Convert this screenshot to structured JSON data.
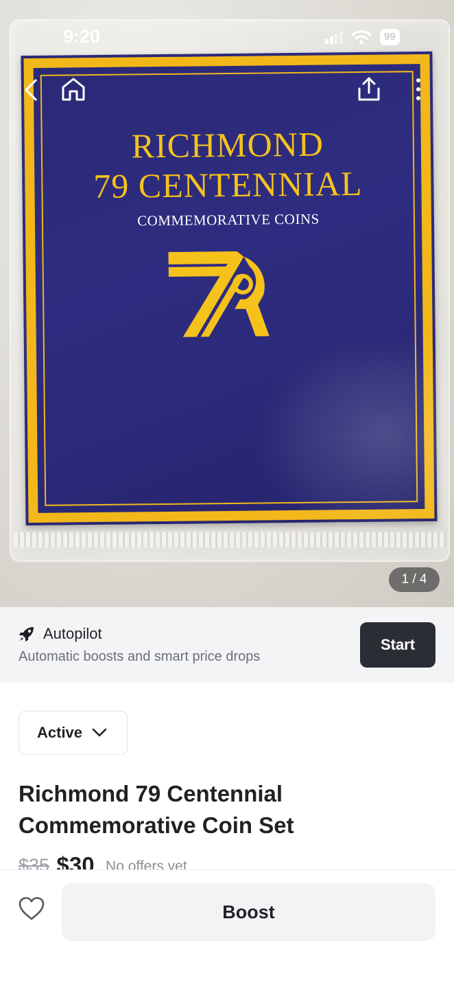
{
  "status_bar": {
    "time": "9:20",
    "battery": "99"
  },
  "photo": {
    "cover_title_line1": "RICHMOND",
    "cover_title_line2": "79 CENTENNIAL",
    "cover_subtitle": "COMMEMORATIVE COINS",
    "page_indicator": "1 / 4"
  },
  "icons": {
    "back": "chevron-left-icon",
    "home": "home-icon",
    "share": "share-icon",
    "more": "more-vertical-icon",
    "autopilot": "rocket-icon",
    "status_dropdown": "chevron-down-icon",
    "favorite": "heart-icon"
  },
  "autopilot": {
    "title": "Autopilot",
    "subtitle": "Automatic boosts and smart price drops",
    "start_label": "Start"
  },
  "listing": {
    "status": "Active",
    "title": "Richmond 79 Centennial Commemorative Coin Set",
    "original_price": "$35",
    "price": "$30",
    "offers_text": "No offers yet"
  },
  "bottom_bar": {
    "boost_label": "Boost"
  },
  "colors": {
    "cover_blue": "#2b2a76",
    "cover_gold": "#f2b81a",
    "start_button": "#2a2d33",
    "banner_bg": "#f3f4f6"
  }
}
